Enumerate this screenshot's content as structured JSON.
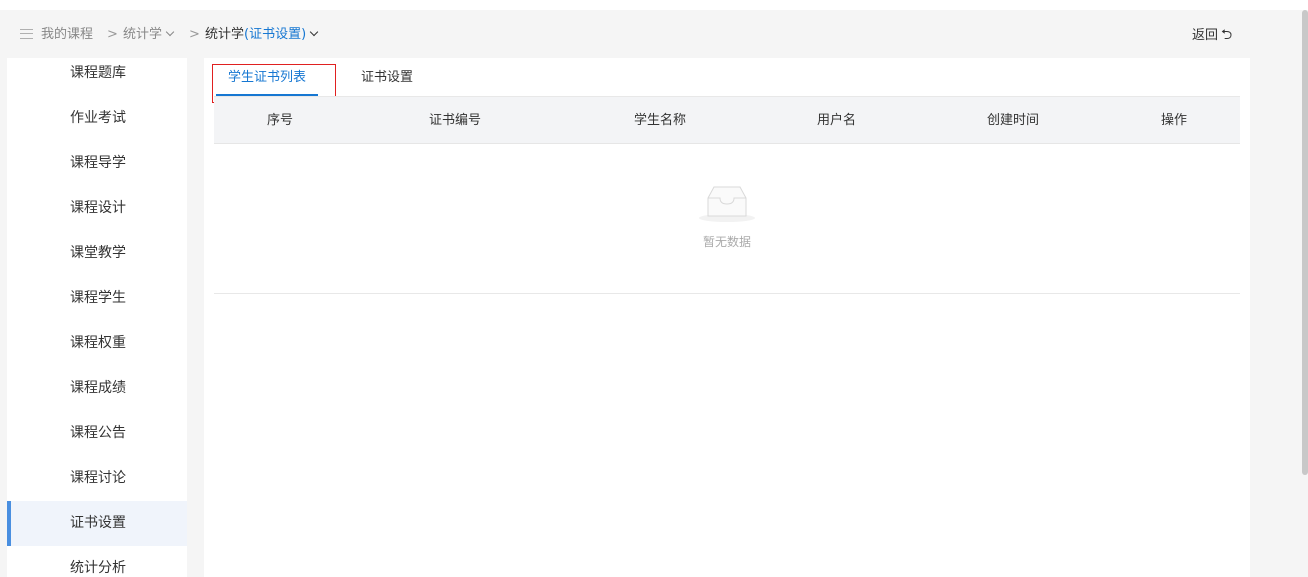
{
  "breadcrumb": {
    "my_courses": "我的课程",
    "separator": ">",
    "course": "统计学",
    "current_prefix": "统计学",
    "current_suffix": "(证书设置)",
    "back_label": "返回",
    "back_icon": "undo-arrow-icon"
  },
  "sidebar": {
    "items": [
      {
        "label": "课程题库"
      },
      {
        "label": "作业考试"
      },
      {
        "label": "课程导学"
      },
      {
        "label": "课程设计"
      },
      {
        "label": "课堂教学"
      },
      {
        "label": "课程学生"
      },
      {
        "label": "课程权重"
      },
      {
        "label": "课程成绩"
      },
      {
        "label": "课程公告"
      },
      {
        "label": "课程讨论"
      },
      {
        "label": "证书设置",
        "active": true
      },
      {
        "label": "统计分析"
      }
    ]
  },
  "tabs": [
    {
      "label": "学生证书列表",
      "active": true
    },
    {
      "label": "证书设置"
    }
  ],
  "table": {
    "columns": [
      "序号",
      "证书编号",
      "学生名称",
      "用户名",
      "创建时间",
      "操作"
    ],
    "rows": [],
    "empty_text": "暂无数据"
  },
  "colors": {
    "accent": "#1677d2",
    "active_indicator": "#4a8fe0",
    "highlight_box": "#e02020"
  }
}
